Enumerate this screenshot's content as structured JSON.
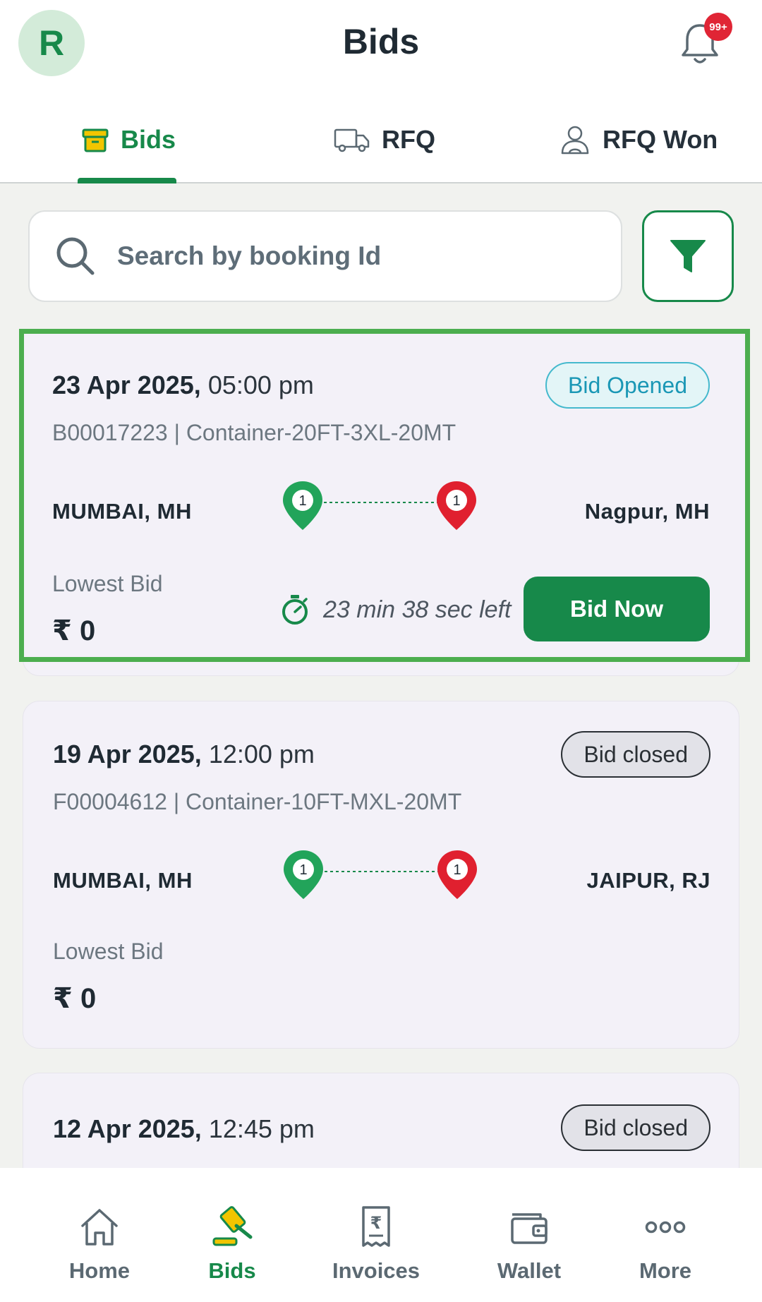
{
  "header": {
    "avatar_initial": "R",
    "title": "Bids",
    "notification_badge": "99+"
  },
  "tabs": [
    {
      "label": "Bids",
      "icon": "package-icon",
      "active": true
    },
    {
      "label": "RFQ",
      "icon": "truck-icon",
      "active": false
    },
    {
      "label": "RFQ Won",
      "icon": "user-badge-icon",
      "active": false
    }
  ],
  "search": {
    "placeholder": "Search by booking Id"
  },
  "cards": [
    {
      "date": "23 Apr 2025,",
      "time": "05:00 pm",
      "status": "Bid Opened",
      "id_line": "B00017223 | Container-20FT-3XL-20MT",
      "origin": "MUMBAI, MH",
      "destination": "Nagpur, MH",
      "origin_stops": "1",
      "destination_stops": "1",
      "lowest_label": "Lowest Bid",
      "lowest_value": "₹ 0",
      "timer": "23 min 38 sec left",
      "action": "Bid Now"
    },
    {
      "date": "19 Apr 2025,",
      "time": "12:00 pm",
      "status": "Bid closed",
      "id_line": "F00004612 | Container-10FT-MXL-20MT",
      "origin": "MUMBAI, MH",
      "destination": "JAIPUR, RJ",
      "origin_stops": "1",
      "destination_stops": "1",
      "lowest_label": "Lowest Bid",
      "lowest_value": "₹ 0"
    },
    {
      "date": "12 Apr 2025,",
      "time": "12:45 pm",
      "status": "Bid closed"
    }
  ],
  "bottom_nav": [
    {
      "label": "Home",
      "icon": "home-icon"
    },
    {
      "label": "Bids",
      "icon": "gavel-icon",
      "active": true
    },
    {
      "label": "Invoices",
      "icon": "invoice-icon"
    },
    {
      "label": "Wallet",
      "icon": "wallet-icon"
    },
    {
      "label": "More",
      "icon": "more-icon"
    }
  ],
  "colors": {
    "primary": "#17894a",
    "highlight_border": "#4cae4f",
    "origin_pin": "#22a45a",
    "destination_pin": "#e0202f",
    "badge_red": "#e02535"
  }
}
